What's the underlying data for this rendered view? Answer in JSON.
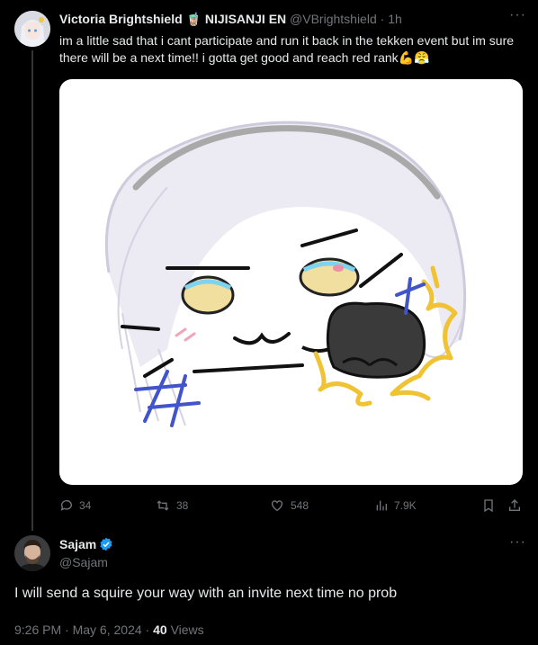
{
  "post": {
    "author_name": "Victoria Brightshield",
    "author_emoji": "🧋",
    "author_affiliation": "NIJISANJI EN",
    "handle": "@VBrightshield",
    "time": "1h",
    "text": "im a little sad that i cant participate and run it back in the tekken event but im sure there will be a next time!! i gotta get good and reach red rank💪😤",
    "replies": "34",
    "reposts": "38",
    "likes": "548",
    "views": "7.9K"
  },
  "reply": {
    "author_name": "Sajam",
    "handle": "@Sajam",
    "text": "I will send a squire your way with an invite next time no prob",
    "time": "9:26 PM",
    "date": "May 6, 2024",
    "views_count": "40",
    "views_label": "Views"
  },
  "colors": {
    "background": "#000000",
    "text": "#e7e9ea",
    "muted": "#71767b",
    "verified": "#1d9bf0"
  }
}
